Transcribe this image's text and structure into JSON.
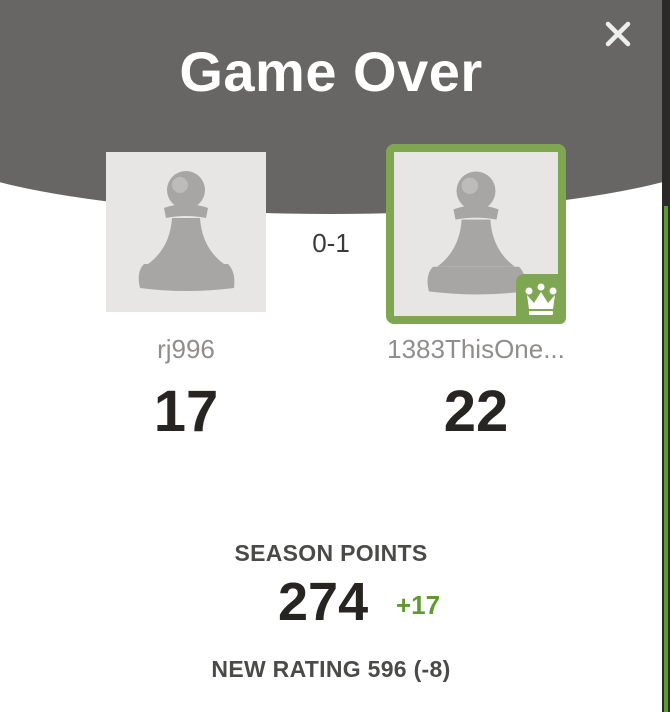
{
  "modal": {
    "title": "Game Over",
    "close_icon": "close-icon"
  },
  "result": {
    "score": "0-1"
  },
  "players": [
    {
      "username": "rj996",
      "points": "17",
      "avatar_icon": "pawn-icon",
      "winner": false
    },
    {
      "username": "1383ThisOne...",
      "points": "22",
      "avatar_icon": "pawn-icon",
      "winner": true,
      "badge_icon": "crown-icon"
    }
  ],
  "season": {
    "label": "SEASON POINTS",
    "total": "274",
    "delta": "+17"
  },
  "rating": {
    "text": "NEW RATING 596 (-8)"
  },
  "colors": {
    "header_bg": "#676664",
    "winner_accent": "#7fa650",
    "positive_delta": "#5f9a2e",
    "avatar_bg": "#e7e6e5",
    "username_text": "#8f8e8c",
    "strong_text": "#262522"
  }
}
